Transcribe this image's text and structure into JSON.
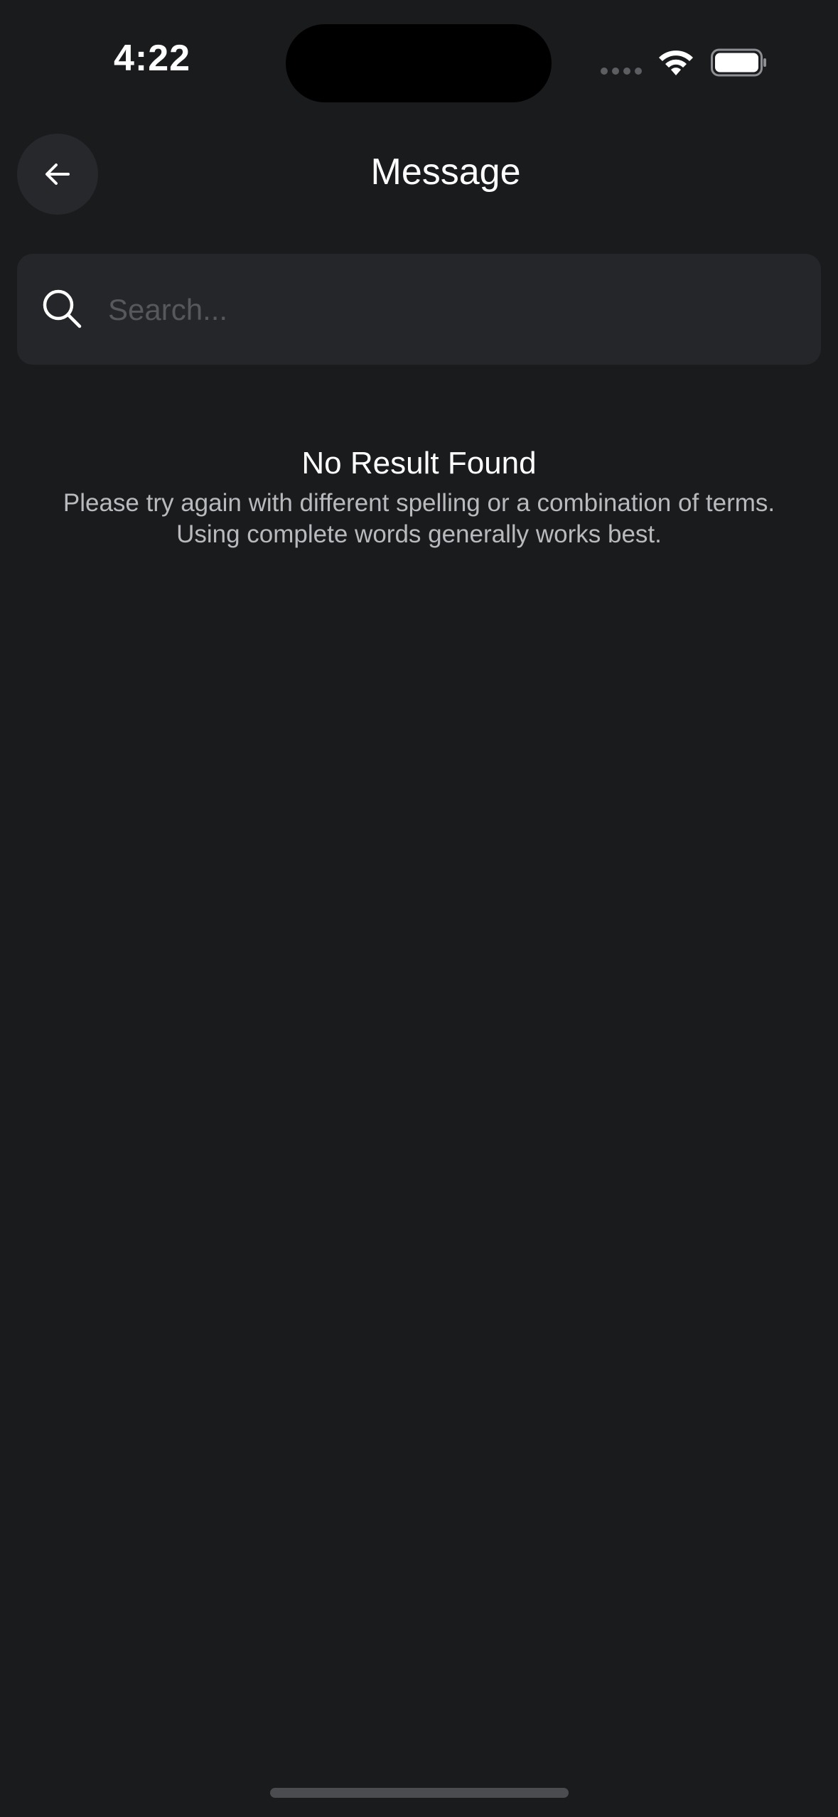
{
  "status_bar": {
    "time": "4:22"
  },
  "header": {
    "title": "Message",
    "back_icon": "arrow-left-icon"
  },
  "search": {
    "placeholder": "Search...",
    "value": "",
    "icon": "search-icon"
  },
  "empty_state": {
    "title": "No Result Found",
    "message": "Please try again with different spelling or a combination of terms. Using complete words generally works best."
  },
  "colors": {
    "background": "#1a1b1d",
    "surface": "#252629",
    "button": "#27282b",
    "text_primary": "#ffffff",
    "text_secondary": "#b9babd",
    "placeholder": "#56585c"
  }
}
